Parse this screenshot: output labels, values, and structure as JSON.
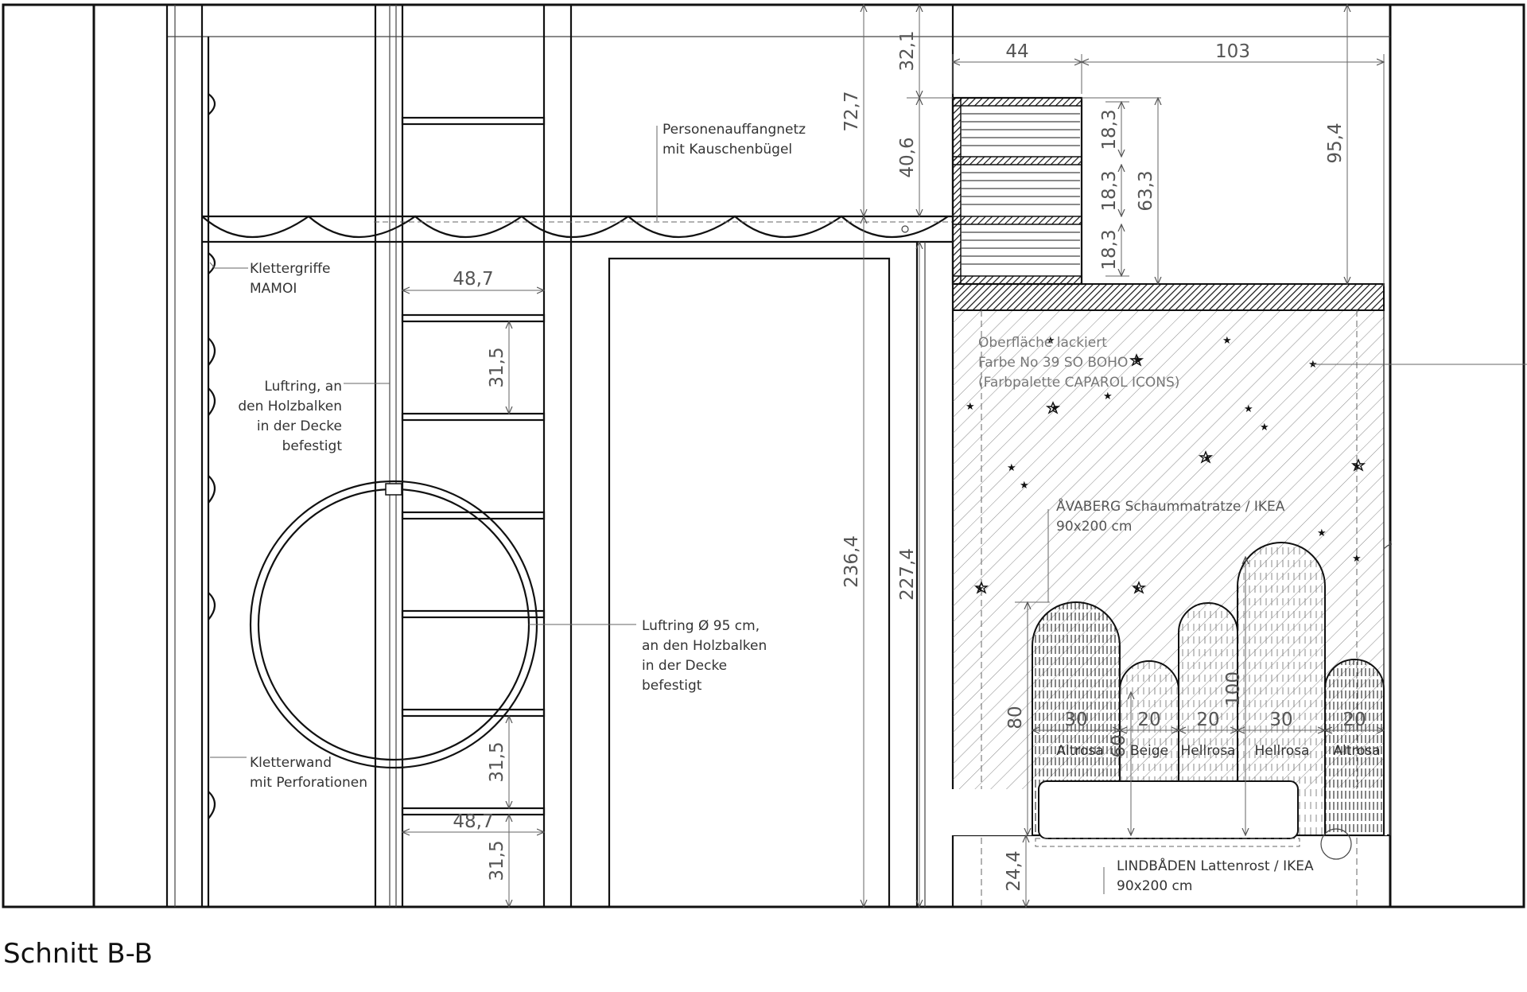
{
  "caption": "Schnitt  B-B",
  "labels": {
    "net": [
      "Personenauffangnetz",
      "mit Kauschenbügel"
    ],
    "grips": [
      "Klettergriffe",
      "MAMOI"
    ],
    "ring_left": [
      "Luftring, an",
      "den Holzbalken",
      "in der Decke",
      "befestigt"
    ],
    "ring_right": [
      "Luftring Ø 95 cm,",
      "an den Holzbalken",
      "in der Decke",
      "befestigt"
    ],
    "wall": [
      "Kletterwand",
      "mit Perforationen"
    ],
    "surface": [
      "Oberfläche lackiert",
      "Farbe No 39 SO BOHO",
      "(Farbpalette CAPAROL ICONS)"
    ],
    "mattress": [
      "ÅVABERG Schaummatratze / IKEA",
      "90x200 cm"
    ],
    "slats": [
      "LINDBÅDEN Lattenrost / IKEA",
      "90x200 cm"
    ]
  },
  "dimensions": {
    "top_width_left": "44",
    "top_width_right": "103",
    "h_32_1": "32,1",
    "h_72_7": "72,7",
    "h_40_6": "40,6",
    "h_18_3_a": "18,3",
    "h_18_3_b": "18,3",
    "h_18_3_c": "18,3",
    "h_63_3": "63,3",
    "h_95_4": "95,4",
    "w_48_7_top": "48,7",
    "h_31_5_top": "31,5",
    "h_31_5_mid": "31,5",
    "w_48_7_bottom": "48,7",
    "h_31_5_bottom": "31,5",
    "h_236_4": "236,4",
    "h_227_4": "227,4",
    "h_24_4": "24,4",
    "h_80": "80",
    "h_60": "60",
    "h_100": "100"
  },
  "headboard": [
    {
      "width": "30",
      "color": "Altrosa"
    },
    {
      "width": "20",
      "color": "Beige"
    },
    {
      "width": "20",
      "color": "Hellrosa"
    },
    {
      "width": "30",
      "color": "Hellrosa"
    },
    {
      "width": "20",
      "color": "Altrosa"
    }
  ]
}
